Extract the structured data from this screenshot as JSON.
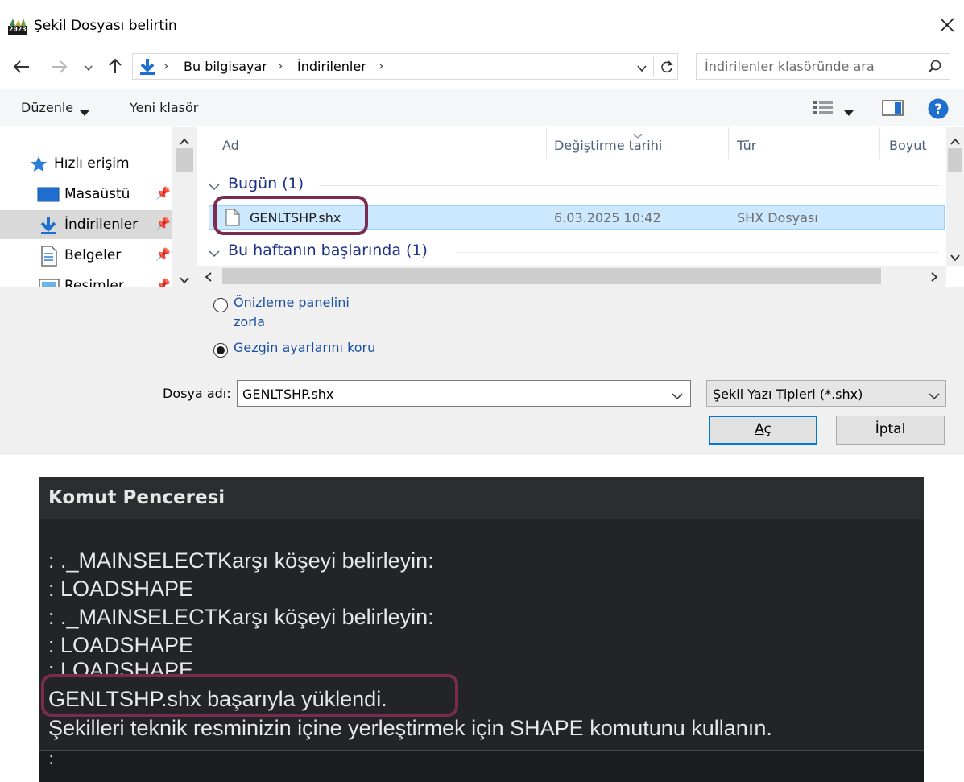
{
  "dialog": {
    "title": "Şekil Dosyası belirtin",
    "app_badge": "2023",
    "address": {
      "root": "Bu bilgisayar",
      "current": "İndirilenler"
    },
    "search": {
      "placeholder": "İndirilenler klasöründe ara"
    },
    "toolbar": {
      "organize": "Düzenle",
      "new_folder": "Yeni klasör"
    },
    "nav": [
      {
        "label": "Hızlı erişim"
      },
      {
        "label": "Masaüstü"
      },
      {
        "label": "İndirilenler"
      },
      {
        "label": "Belgeler"
      },
      {
        "label": "Resimler"
      }
    ],
    "columns": {
      "name": "Ad",
      "date": "Değiştirme tarihi",
      "type": "Tür",
      "size": "Boyut"
    },
    "groups": {
      "today": "Bugün (1)",
      "early_week": "Bu haftanın başlarında (1)"
    },
    "file": {
      "name": "GENLTSHP.shx",
      "date": "6.03.2025 10:42",
      "type": "SHX Dosyası"
    },
    "options": {
      "preview_line1": "Önizleme panelini",
      "preview_line2": "zorla",
      "keep": "Gezgin ayarlarını koru"
    },
    "filename_label_pre": "D",
    "filename_label_u": "o",
    "filename_label_post": "sya adı:",
    "filename_value": "GENLTSHP.shx",
    "filetype": "Şekil Yazı Tipleri (*.shx)",
    "open_button_u": "A",
    "open_button_rest": "ç",
    "cancel_button": "İptal"
  },
  "command_window": {
    "title": "Komut Penceresi",
    "lines": [
      ": ._MAINSELECTKarşı köşeyi belirleyin:",
      ": LOADSHAPE",
      ": ._MAINSELECTKarşı köşeyi belirleyin:",
      ": LOADSHAPE",
      ": LOADSHAPE",
      "GENLTSHP.shx başarıyla yüklendi.",
      "Şekilleri teknik resminizin içine yerleştirmek için SHAPE komutunu kullanın."
    ],
    "prompt": ":"
  },
  "colors": {
    "highlight": "#7b2b4d",
    "selection": "#cce8ff",
    "link": "#1b4fa5",
    "cmd_bg": "#222428"
  }
}
